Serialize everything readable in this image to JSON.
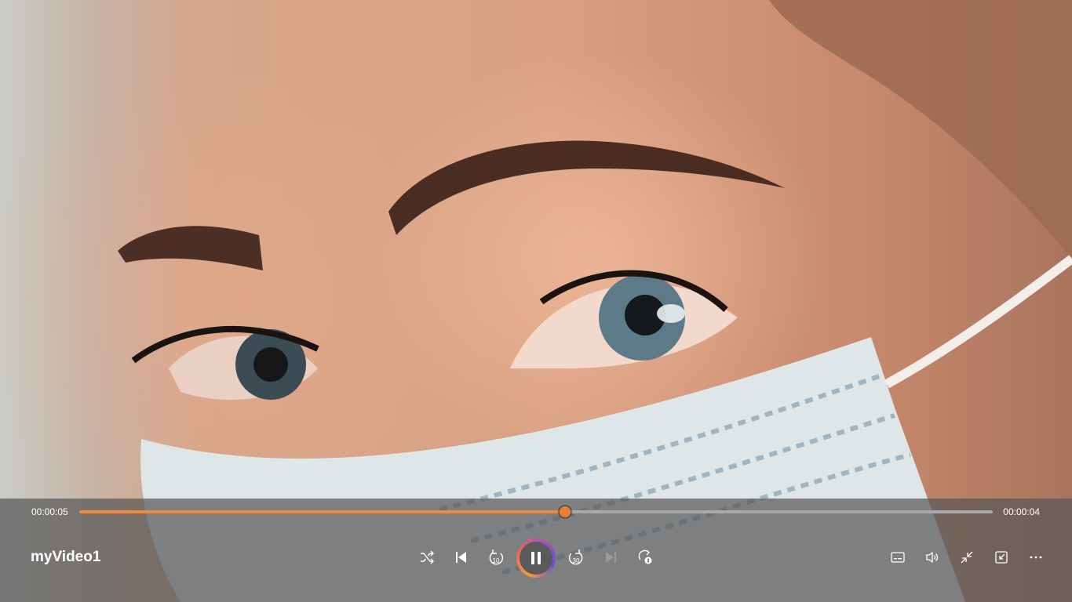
{
  "player": {
    "title": "myVideo1",
    "current_time": "00:00:05",
    "total_time": "00:00:04",
    "progress_fraction": 0.532,
    "accent_color": "#f08a3a"
  },
  "controls": {
    "center": [
      {
        "name": "shuffle-button",
        "icon": "shuffle-icon"
      },
      {
        "name": "previous-button",
        "icon": "skip-previous-icon"
      },
      {
        "name": "rewind-10-button",
        "icon": "rewind-10-icon"
      },
      {
        "name": "play-pause-button",
        "icon": "pause-icon"
      },
      {
        "name": "forward-30-button",
        "icon": "forward-30-icon"
      },
      {
        "name": "next-button",
        "icon": "skip-next-icon"
      },
      {
        "name": "repeat-button",
        "icon": "repeat-one-icon"
      }
    ],
    "right": [
      {
        "name": "captions-button",
        "icon": "closed-captions-icon"
      },
      {
        "name": "volume-button",
        "icon": "volume-icon"
      },
      {
        "name": "exit-fullscreen-button",
        "icon": "exit-fullscreen-icon"
      },
      {
        "name": "mini-player-button",
        "icon": "mini-player-icon"
      },
      {
        "name": "more-options-button",
        "icon": "more-horizontal-icon"
      }
    ],
    "rewind_label": "10",
    "forward_label": "30"
  }
}
